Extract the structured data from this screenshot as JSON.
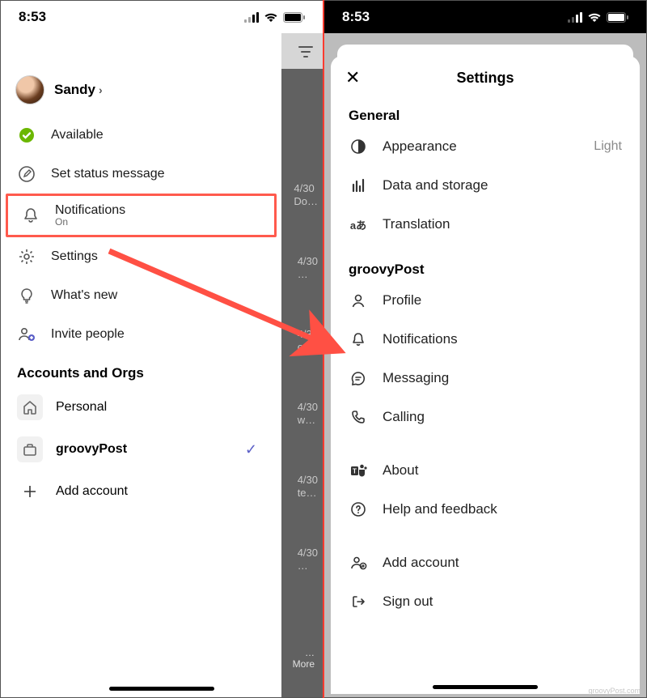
{
  "status_time": "8:53",
  "left": {
    "profile_name": "Sandy",
    "menu": {
      "available": "Available",
      "set_status": "Set status message",
      "notifications": "Notifications",
      "notifications_sub": "On",
      "settings": "Settings",
      "whats_new": "What's new",
      "invite": "Invite people"
    },
    "accounts_header": "Accounts and Orgs",
    "accounts": {
      "personal": "Personal",
      "org": "groovyPost",
      "add": "Add account"
    },
    "bg": {
      "d1": "4/30",
      "d1b": "Do…",
      "d2": "4/30",
      "d3": "4/30",
      "d3b": "o…",
      "d4": "4/30",
      "d4b": "w…",
      "d5": "4/30",
      "d5b": "te…",
      "d6": "4/30",
      "more": "…\nMore"
    }
  },
  "right": {
    "title": "Settings",
    "general_header": "General",
    "general": {
      "appearance": "Appearance",
      "appearance_value": "Light",
      "data": "Data and storage",
      "translation": "Translation"
    },
    "org_header": "groovyPost",
    "org": {
      "profile": "Profile",
      "notifications": "Notifications",
      "messaging": "Messaging",
      "calling": "Calling"
    },
    "about": "About",
    "help": "Help and feedback",
    "add_account": "Add account",
    "sign_out": "Sign out"
  },
  "watermark": "groovyPost.com"
}
